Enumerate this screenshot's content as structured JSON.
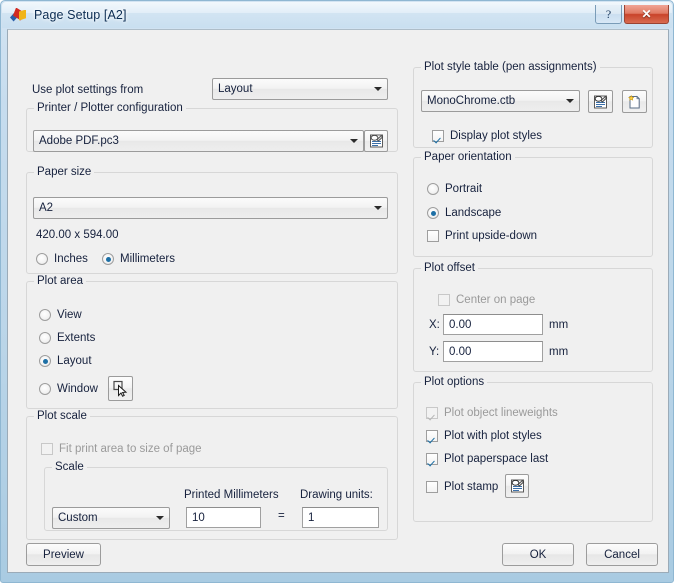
{
  "window": {
    "title": "Page Setup [A2]",
    "app_icon": "autocad-icon",
    "help_button": "?",
    "close_button": "✕"
  },
  "left": {
    "use_plot_settings_from_label": "Use plot settings from",
    "use_plot_settings_from_value": "Layout",
    "printer_group": {
      "title": "Printer / Plotter configuration",
      "value": "Adobe PDF.pc3",
      "properties_icon": "printer-properties-icon"
    },
    "paper_size_group": {
      "title": "Paper size",
      "value": "A2",
      "dimensions": "420.00 x 594.00",
      "units": [
        {
          "label": "Inches",
          "checked": false
        },
        {
          "label": "Millimeters",
          "checked": true
        }
      ]
    },
    "plot_area_group": {
      "title": "Plot area",
      "options": [
        {
          "label": "View",
          "checked": false
        },
        {
          "label": "Extents",
          "checked": false
        },
        {
          "label": "Layout",
          "checked": true
        },
        {
          "label": "Window",
          "checked": false
        }
      ],
      "window_pick_icon": "pick-window-icon"
    },
    "plot_scale_group": {
      "title": "Plot scale",
      "fit_label": "Fit print area to size of page",
      "fit_checked": false,
      "fit_disabled": true,
      "scale_group_title": "Scale",
      "scale_value": "Custom",
      "printed_units_label": "Printed Millimeters",
      "printed_units_value": "10",
      "equals": "=",
      "drawing_units_label": "Drawing units:",
      "drawing_units_value": "1"
    }
  },
  "right": {
    "plot_style_group": {
      "title": "Plot style table (pen assignments)",
      "value": "MonoChrome.ctb",
      "edit_icon": "edit-plot-style-table-icon",
      "new_icon": "new-plot-style-table-icon",
      "display_styles_label": "Display plot styles",
      "display_styles_checked": true
    },
    "orientation_group": {
      "title": "Paper orientation",
      "options": [
        {
          "label": "Portrait",
          "checked": false
        },
        {
          "label": "Landscape",
          "checked": true
        }
      ],
      "upside_down_label": "Print upside-down",
      "upside_down_checked": false
    },
    "plot_offset_group": {
      "title": "Plot offset",
      "center_label": "Center on page",
      "center_checked": false,
      "center_disabled": true,
      "x_label": "X:",
      "x_value": "0.00",
      "x_units": "mm",
      "y_label": "Y:",
      "y_value": "0.00",
      "y_units": "mm"
    },
    "plot_options_group": {
      "title": "Plot options",
      "items": [
        {
          "label": "Plot object lineweights",
          "checked": true,
          "disabled": true
        },
        {
          "label": "Plot with plot styles",
          "checked": true,
          "disabled": false
        },
        {
          "label": "Plot paperspace last",
          "checked": true,
          "disabled": false
        },
        {
          "label": "Plot stamp",
          "checked": false,
          "disabled": false
        }
      ],
      "plot_stamp_settings_icon": "plot-stamp-settings-icon"
    }
  },
  "footer": {
    "preview_label": "Preview",
    "ok_label": "OK",
    "cancel_label": "Cancel"
  },
  "colors": {
    "dialog_background": "#f0f0f0",
    "frame": "#bcd6e9",
    "accent": "#1d6fa5",
    "close_button": "#c9432a",
    "text": "#16213d",
    "disabled_text": "#9a9a9a"
  }
}
